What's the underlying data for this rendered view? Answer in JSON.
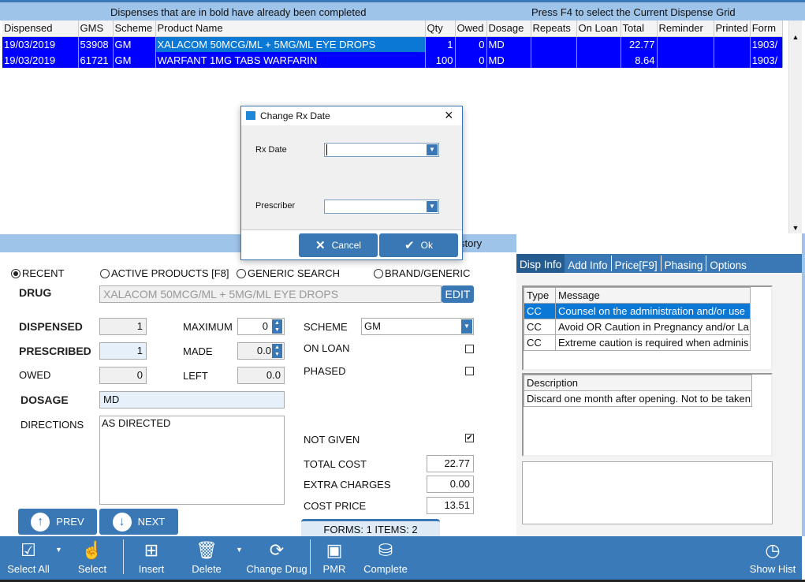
{
  "banner": {
    "left": "Dispenses that are in bold have already been completed",
    "right": "Press F4 to select the Current Dispense Grid"
  },
  "grid": {
    "columns": [
      "Dispensed",
      "GMS",
      "Scheme",
      "Product Name",
      "Qty",
      "Owed",
      "Dosage",
      "Repeats",
      "On Loan",
      "Total",
      "Reminder",
      "Printed",
      "Form"
    ],
    "rows": [
      [
        "19/03/2019",
        "53908",
        "GM",
        "XALACOM 50MCG/ML + 5MG/ML EYE DROPS",
        "1",
        "0",
        "MD",
        "",
        "",
        "22.77",
        "",
        "",
        "1903/"
      ],
      [
        "19/03/2019",
        "61721",
        "GM",
        "WARFANT 1MG TABS WARFARIN",
        "100",
        "0",
        "MD",
        "",
        "",
        "8.64",
        "",
        "",
        "1903/"
      ]
    ]
  },
  "midbar": {
    "label": "story"
  },
  "dialog": {
    "title": "Change Rx Date",
    "rx_date_label": "Rx Date",
    "rx_date_value": "",
    "prescriber_label": "Prescriber",
    "prescriber_value": "",
    "cancel": "Cancel",
    "ok": "Ok"
  },
  "search": {
    "options": [
      "RECENT",
      "ACTIVE PRODUCTS [F8]",
      "GENERIC SEARCH",
      "BRAND/GENERIC"
    ],
    "selected": "RECENT"
  },
  "form": {
    "drug_label": "DRUG",
    "drug_value": "XALACOM 50MCG/ML + 5MG/ML EYE DROPS",
    "edit": "EDIT",
    "dispensed_label": "DISPENSED",
    "dispensed": "1",
    "prescribed_label": "PRESCRIBED",
    "prescribed": "1",
    "owed_label": "OWED",
    "owed": "0",
    "maximum_label": "MAXIMUM",
    "maximum": "0",
    "made_label": "MADE",
    "made": "0.0",
    "left_label": "LEFT",
    "left": "0.0",
    "dosage_label": "DOSAGE",
    "dosage": "MD",
    "directions_label": "DIRECTIONS",
    "directions": "AS DIRECTED",
    "scheme_label": "SCHEME",
    "scheme": "GM",
    "on_loan_label": "ON LOAN",
    "on_loan": false,
    "phased_label": "PHASED",
    "phased": false,
    "not_given_label": "NOT GIVEN",
    "not_given": true,
    "total_cost_label": "TOTAL COST",
    "total_cost": "22.77",
    "extra_charges_label": "EXTRA CHARGES",
    "extra_charges": "0.00",
    "cost_price_label": "COST PRICE",
    "cost_price": "13.51",
    "prev": "PREV",
    "next": "NEXT",
    "forms_items": "FORMS: 1  ITEMS: 2"
  },
  "tabs": [
    "Disp Info",
    "Add Info",
    "Price[F9]",
    "Phasing",
    "Options"
  ],
  "messages": {
    "columns": [
      "Type",
      "Message"
    ],
    "rows": [
      [
        "CC",
        "Counsel on the administration and/or use"
      ],
      [
        "CC",
        "Avoid OR Caution in Pregnancy and/or La"
      ],
      [
        "CC",
        "Extreme caution is required when adminis"
      ]
    ]
  },
  "description": {
    "header": "Description",
    "text": "Discard one month after opening. Not to be taken"
  },
  "toolbar": {
    "select_all": "Select All",
    "select": "Select",
    "insert": "Insert",
    "delete": "Delete",
    "change_drug": "Change Drug",
    "pmr": "PMR",
    "complete": "Complete",
    "show_hist": "Show Hist"
  },
  "colors": {
    "accent": "#3a78b5",
    "grid_row": "#0000ff",
    "selected_cell": "#0a78d4",
    "banner": "#9fc4ea"
  }
}
